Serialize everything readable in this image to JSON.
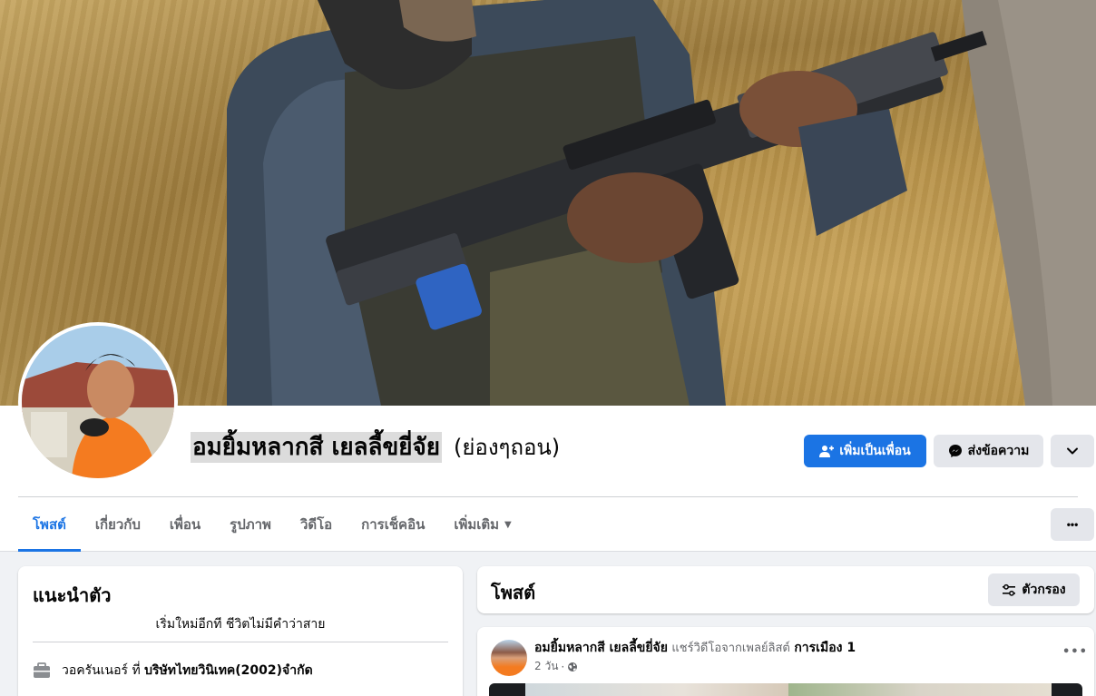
{
  "profile": {
    "name": "อมยิ้มหลากสี เยลลี้ขยี่จัย",
    "alternate_name": "(ย่องๆถอน)"
  },
  "actions": {
    "add_friend": "เพิ่มเป็นเพื่อน",
    "message": "ส่งข้อความ",
    "more_icon": "chevron-down-icon"
  },
  "tabs": [
    {
      "label": "โพสต์",
      "active": true
    },
    {
      "label": "เกี่ยวกับ",
      "active": false
    },
    {
      "label": "เพื่อน",
      "active": false
    },
    {
      "label": "รูปภาพ",
      "active": false
    },
    {
      "label": "วิดีโอ",
      "active": false
    },
    {
      "label": "การเช็คอิน",
      "active": false
    },
    {
      "label": "เพิ่มเติม",
      "active": false
    }
  ],
  "tabs_more_button": "•••",
  "intro": {
    "title": "แนะนำตัว",
    "bio": "เริ่มใหม่อีกที ชีวิตไม่มีคำว่าสาย",
    "work_prefix": "วอครันเนอร์ ที่",
    "work_company": "บริษัทไทยวินิเทค(2002)จำกัด"
  },
  "posts_section": {
    "title": "โพสต์",
    "filter_label": "ตัวกรอง"
  },
  "post": {
    "author": "อมยิ้มหลากสี เยลลี้ขยี่จัย",
    "action_text": "แชร์วิดีโอจากเพลย์ลิสต์",
    "playlist": "การเมือง 1",
    "time": "2 วัน",
    "separator": "·",
    "menu": "•••"
  },
  "colors": {
    "accent": "#1b74e4",
    "background": "#f0f2f5",
    "muted_text": "#65676b"
  }
}
